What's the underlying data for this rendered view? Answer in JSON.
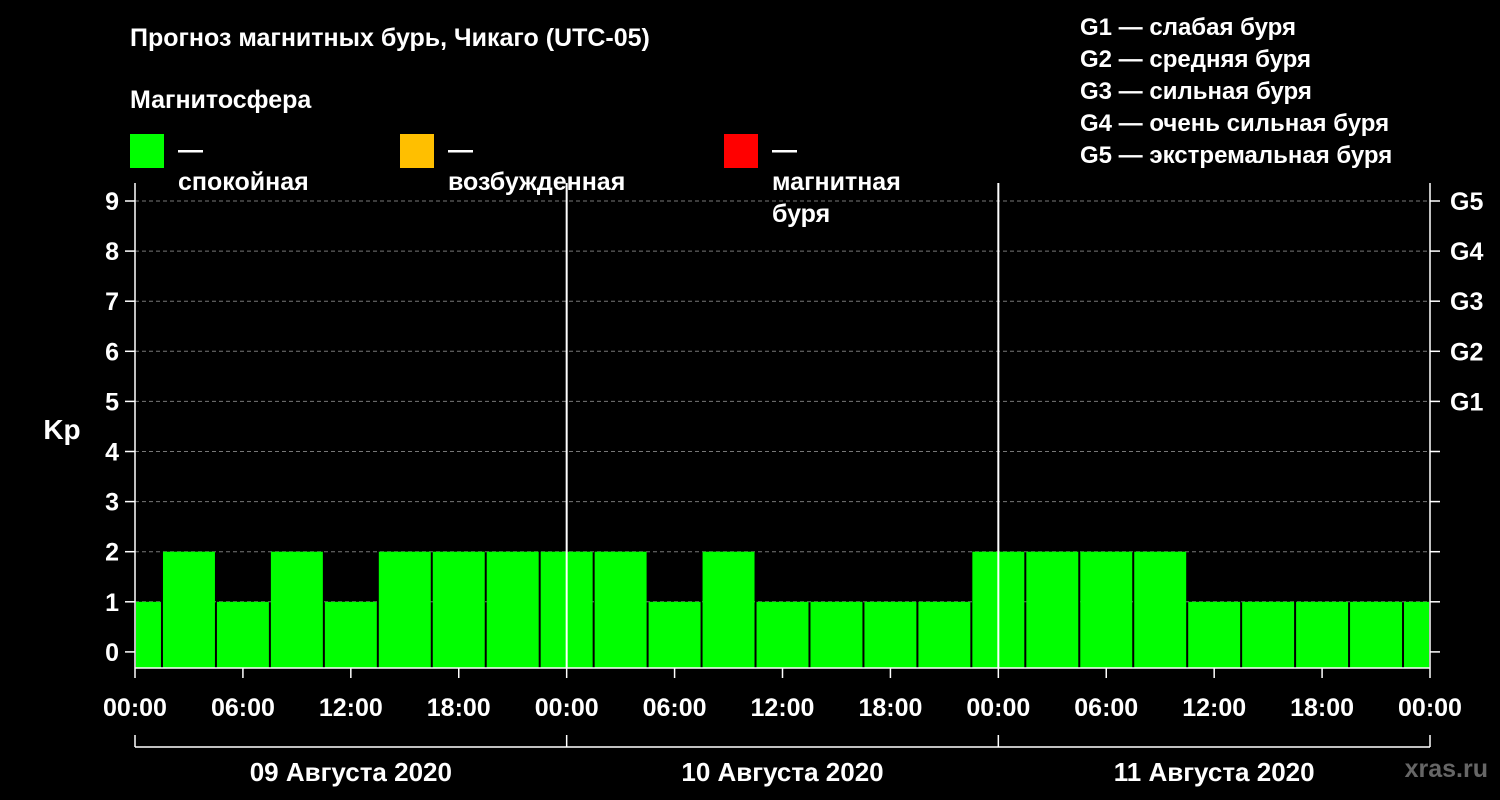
{
  "title": "Прогноз магнитных бурь, Чикаго (UTC-05)",
  "magnetosphere": {
    "title": "Магнитосфера",
    "items": [
      {
        "label": "— спокойная",
        "color": "#00ff00"
      },
      {
        "label": "— возбужденная",
        "color": "#ffbf00"
      },
      {
        "label": "— магнитная буря",
        "color": "#ff0000"
      }
    ]
  },
  "g_legend": [
    "G1 — слабая буря",
    "G2 — средняя буря",
    "G3 — сильная буря",
    "G4 — очень сильная буря",
    "G5 — экстремальная буря"
  ],
  "site": "xras.ru",
  "chart_data": {
    "type": "bar",
    "ylabel": "Kp",
    "ylim": [
      0,
      9
    ],
    "y_ticks": [
      "0",
      "1",
      "2",
      "3",
      "4",
      "5",
      "6",
      "7",
      "8",
      "9"
    ],
    "right_ticks": [
      {
        "kp": 5,
        "label": "G1"
      },
      {
        "kp": 6,
        "label": "G2"
      },
      {
        "kp": 7,
        "label": "G3"
      },
      {
        "kp": 8,
        "label": "G4"
      },
      {
        "kp": 9,
        "label": "G5"
      }
    ],
    "x_tick_labels": [
      "00:00",
      "06:00",
      "12:00",
      "18:00",
      "00:00",
      "06:00",
      "12:00",
      "18:00",
      "00:00",
      "06:00",
      "12:00",
      "18:00",
      "00:00"
    ],
    "dates": [
      "09 Августа 2020",
      "10 Августа 2020",
      "11 Августа 2020"
    ],
    "interval_hours": 3,
    "values": [
      1,
      2,
      1,
      2,
      1,
      2,
      2,
      2,
      2,
      2,
      1,
      2,
      1,
      1,
      1,
      1,
      2,
      2,
      2,
      2,
      1,
      1,
      1,
      1,
      1
    ],
    "bar_color": "#00ff00",
    "grid": true
  }
}
